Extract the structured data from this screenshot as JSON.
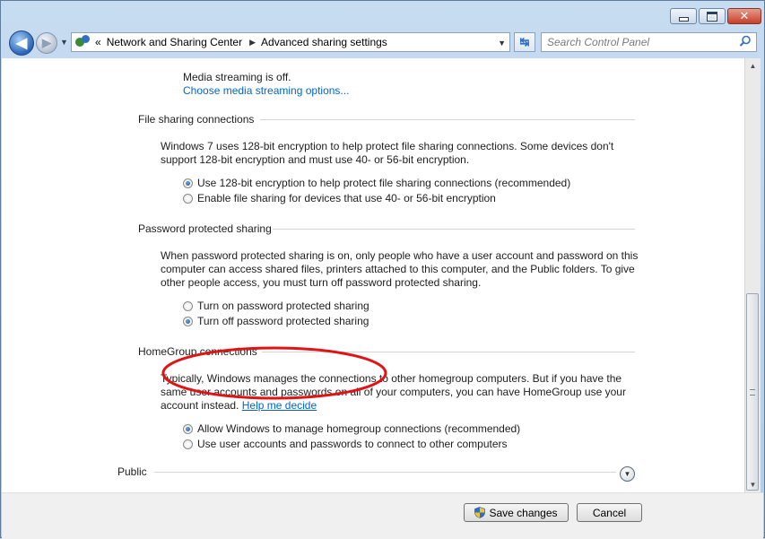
{
  "window": {
    "minimize_glyph": "minimize",
    "maximize_glyph": "maximize",
    "close_glyph": "✕"
  },
  "nav": {
    "back_glyph": "◀",
    "forward_glyph": "▶",
    "address": {
      "prefix": "«",
      "crumbs": [
        "Network and Sharing Center",
        "Advanced sharing settings"
      ],
      "separator": "▶"
    },
    "search_placeholder": "Search Control Panel"
  },
  "media_streaming": {
    "status": "Media streaming is off.",
    "link": "Choose media streaming options..."
  },
  "file_sharing": {
    "title": "File sharing connections",
    "description_line1": "Windows 7 uses 128-bit encryption to help protect file sharing connections. Some devices don't",
    "description_line2": "support 128-bit encryption and must use 40- or 56-bit encryption.",
    "options": [
      {
        "label": "Use 128-bit encryption to help protect file sharing connections (recommended)",
        "selected": true
      },
      {
        "label": "Enable file sharing for devices that use 40- or 56-bit encryption",
        "selected": false
      }
    ]
  },
  "password_sharing": {
    "title": "Password protected sharing",
    "description_line1": "When password protected sharing is on, only people who have a user account and password on this",
    "description_line2": "computer can access shared files, printers attached to this computer, and the Public folders. To give",
    "description_line3": "other people access, you must turn off password protected sharing.",
    "options": [
      {
        "label": "Turn on password protected sharing",
        "selected": false
      },
      {
        "label": "Turn off password protected sharing",
        "selected": true
      }
    ],
    "highlight_color": "#e01414"
  },
  "homegroup": {
    "title": "HomeGroup connections",
    "description_line1": "Typically, Windows manages the connections to other homegroup computers. But if you have the",
    "description_line2": "same user accounts and passwords on all of your computers, you can have HomeGroup use your",
    "description_line3_prefix": "account instead.",
    "help_link": "Help me decide",
    "options": [
      {
        "label": "Allow Windows to manage homegroup connections (recommended)",
        "selected": true
      },
      {
        "label": "Use user accounts and passwords to connect to other computers",
        "selected": false
      }
    ]
  },
  "public": {
    "title": "Public"
  },
  "buttons": {
    "save": "Save changes",
    "cancel": "Cancel"
  },
  "colors": {
    "link": "#0066cc",
    "chrome": "#bcd3ea",
    "highlight": "#e01414"
  }
}
